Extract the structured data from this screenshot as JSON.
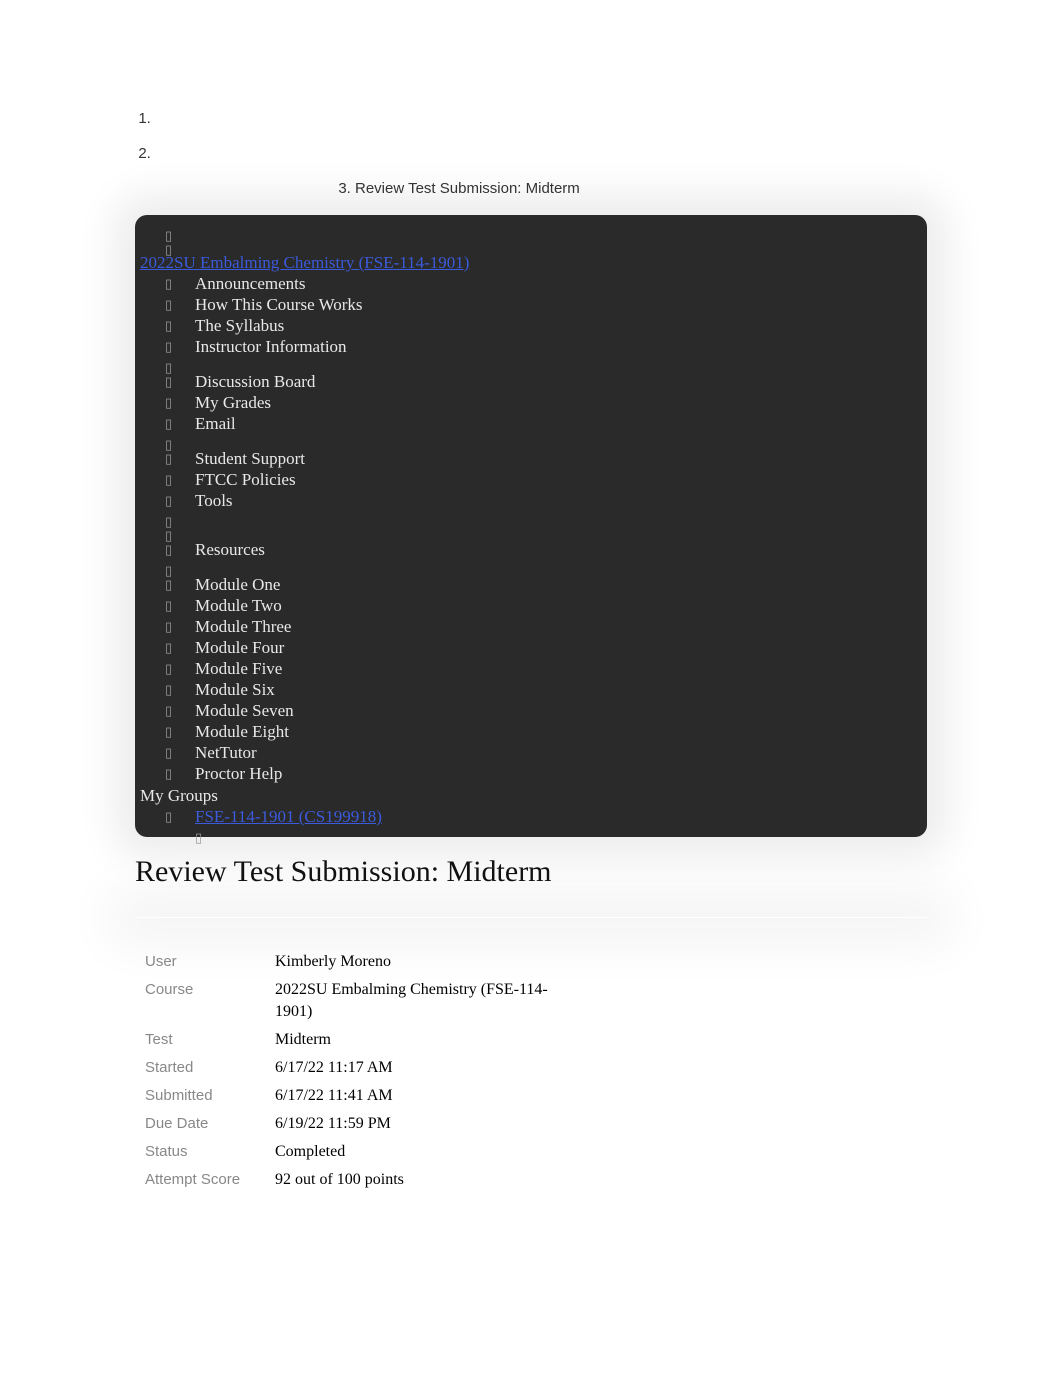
{
  "breadcrumbs": {
    "item1": "",
    "item2": "",
    "item3": "Review Test Submission: Midterm"
  },
  "course": {
    "title": "2022SU Embalming Chemistry (FSE-114-1901)"
  },
  "nav": {
    "items": [
      {
        "label": "Announcements"
      },
      {
        "label": "How This Course Works"
      },
      {
        "label": "The Syllabus"
      },
      {
        "label": "Instructor Information"
      },
      {
        "label": "",
        "spacer": true
      },
      {
        "label": "Discussion Board"
      },
      {
        "label": "My Grades"
      },
      {
        "label": "Email"
      },
      {
        "label": "",
        "spacer": true
      },
      {
        "label": "Student Support"
      },
      {
        "label": "FTCC Policies"
      },
      {
        "label": "Tools"
      },
      {
        "label": "",
        "spacer": true
      },
      {
        "label": "",
        "spacer": true
      },
      {
        "label": "Resources"
      },
      {
        "label": "",
        "spacer": true
      },
      {
        "label": "Module One"
      },
      {
        "label": "Module Two"
      },
      {
        "label": "Module Three"
      },
      {
        "label": "Module Four"
      },
      {
        "label": "Module Five"
      },
      {
        "label": "Module Six"
      },
      {
        "label": "Module Seven"
      },
      {
        "label": "Module Eight"
      },
      {
        "label": "NetTutor"
      },
      {
        "label": "Proctor Help"
      }
    ]
  },
  "groups": {
    "heading": "My Groups",
    "items": [
      {
        "label": "FSE-114-1901 (CS199918)"
      }
    ]
  },
  "page": {
    "title": "Review Test Submission: Midterm"
  },
  "info": {
    "rows": [
      {
        "label": "User",
        "value": "Kimberly Moreno"
      },
      {
        "label": "Course",
        "value": "2022SU Embalming Chemistry (FSE-114-1901)"
      },
      {
        "label": "Test",
        "value": "Midterm"
      },
      {
        "label": "Started",
        "value": "6/17/22 11:17 AM"
      },
      {
        "label": "Submitted",
        "value": "6/17/22 11:41 AM"
      },
      {
        "label": "Due Date",
        "value": "6/19/22 11:59 PM"
      },
      {
        "label": "Status",
        "value": "Completed"
      },
      {
        "label": "Attempt Score",
        "value": "92 out of 100 points"
      }
    ]
  }
}
